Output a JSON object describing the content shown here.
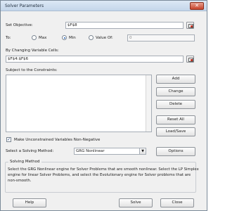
{
  "window": {
    "title": "Solver Parameters",
    "close_symbol": "✕"
  },
  "objective": {
    "label": "Set Objective:",
    "value": "$F$8"
  },
  "to": {
    "label": "To:",
    "options": [
      {
        "label": "Max",
        "selected": false
      },
      {
        "label": "Min",
        "selected": true
      },
      {
        "label": "Value Of:",
        "selected": false
      }
    ],
    "value_of": "0"
  },
  "changing_cells": {
    "label": "By Changing Variable Cells:",
    "value": "$F$4:$F$6"
  },
  "constraints": {
    "label": "Subject to the Constraints:"
  },
  "constraint_buttons": {
    "add": "Add",
    "change": "Change",
    "delete": "Delete",
    "reset_all": "Reset All",
    "load_save": "Load/Save"
  },
  "nonnegative": {
    "label": "Make Unconstrained Variables Non-Negative",
    "checked": true,
    "mark": "✓"
  },
  "method": {
    "label": "Select a Solving Method:",
    "value": "GRG Nonlinear",
    "options_button": "Options",
    "arrow": "▼"
  },
  "solving_method": {
    "title": "Solving Method",
    "line1": "Select the GRG Nonlinear engine for Solver Problems that are smooth nonlinear. Select the LP Simplex",
    "line2": "engine for linear Solver Problems, and select the Evolutionary engine for Solver problems that are",
    "line3": "non-smooth."
  },
  "footer": {
    "help": "Help",
    "solve": "Solve",
    "close": "Close"
  }
}
